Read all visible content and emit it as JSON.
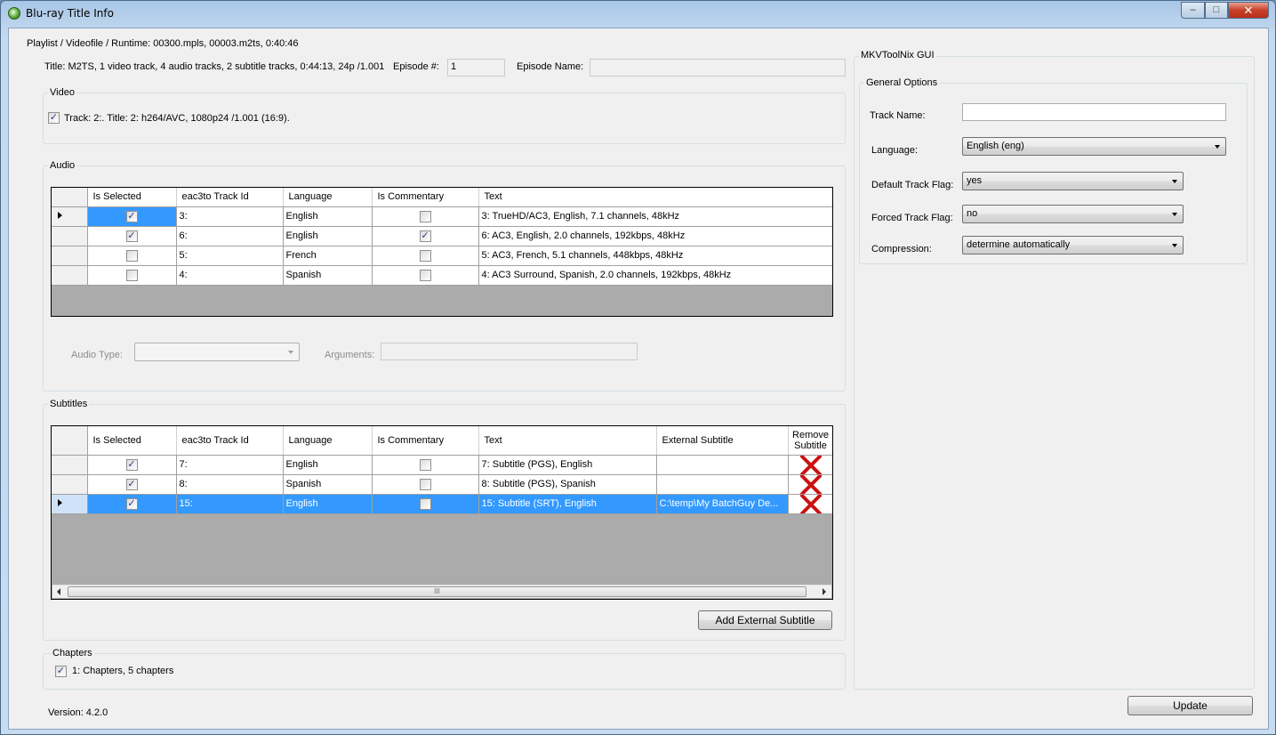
{
  "window": {
    "title": "Blu-ray Title Info",
    "controls": {
      "minimize": "–",
      "maximize": "□",
      "close": "✕"
    }
  },
  "playlist": {
    "label": "Playlist / Videofile / Runtime: 00300.mpls, 00003.m2ts, 0:40:46",
    "title_info": "Title: M2TS, 1 video track, 4 audio tracks, 2 subtitle tracks, 0:44:13, 24p /1.001",
    "episode_num_label": "Episode #:",
    "episode_num_value": "1",
    "episode_name_label": "Episode Name:",
    "episode_name_value": ""
  },
  "video": {
    "label": "Video",
    "track": "Track: 2:. Title: 2: h264/AVC, 1080p24 /1.001 (16:9).",
    "checked": true
  },
  "audio": {
    "label": "Audio",
    "columns": [
      "Is Selected",
      "eac3to Track Id",
      "Language",
      "Is Commentary",
      "Text"
    ],
    "rows": [
      {
        "selected": true,
        "id": "3:",
        "language": "English",
        "commentary": false,
        "text": "3: TrueHD/AC3, English, 7.1 channels, 48kHz",
        "current": true
      },
      {
        "selected": true,
        "id": "6:",
        "language": "English",
        "commentary": true,
        "text": "6: AC3, English, 2.0 channels, 192kbps, 48kHz",
        "current": false
      },
      {
        "selected": false,
        "id": "5:",
        "language": "French",
        "commentary": false,
        "text": "5: AC3, French, 5.1 channels, 448kbps, 48kHz",
        "current": false
      },
      {
        "selected": false,
        "id": "4:",
        "language": "Spanish",
        "commentary": false,
        "text": "4: AC3 Surround, Spanish, 2.0 channels, 192kbps, 48kHz",
        "current": false
      }
    ],
    "audio_type_label": "Audio Type:",
    "audio_type_value": "",
    "arguments_label": "Arguments:",
    "arguments_value": ""
  },
  "subtitles": {
    "label": "Subtitles",
    "columns": [
      "Is Selected",
      "eac3to Track Id",
      "Language",
      "Is Commentary",
      "Text",
      "External Subtitle",
      "Remove Subtitle"
    ],
    "remove_col_line1": "Remove",
    "remove_col_line2": "Subtitle",
    "rows": [
      {
        "selected": true,
        "id": "7:",
        "language": "English",
        "commentary": false,
        "text": "7: Subtitle (PGS), English",
        "external": "",
        "current": false
      },
      {
        "selected": true,
        "id": "8:",
        "language": "Spanish",
        "commentary": false,
        "text": "8: Subtitle (PGS), Spanish",
        "external": "",
        "current": false
      },
      {
        "selected": true,
        "id": "15:",
        "language": "English",
        "commentary": false,
        "text": "15: Subtitle (SRT), English",
        "external": "C:\\temp\\My BatchGuy De...",
        "current": true
      }
    ],
    "scroll_grip": "III",
    "add_button": "Add External Subtitle"
  },
  "chapters": {
    "label": "Chapters",
    "item": "1: Chapters, 5 chapters",
    "checked": true
  },
  "mkv": {
    "label": "MKVToolNix GUI",
    "general_label": "General Options",
    "track_name_label": "Track Name:",
    "track_name_value": "",
    "language_label": "Language:",
    "language_value": "English (eng)",
    "default_flag_label": "Default Track Flag:",
    "default_flag_value": "yes",
    "forced_flag_label": "Forced Track Flag:",
    "forced_flag_value": "no",
    "compression_label": "Compression:",
    "compression_value": "determine automatically"
  },
  "footer": {
    "version": "Version: 4.2.0",
    "update_button": "Update"
  },
  "colors": {
    "selection": "#3399ff",
    "grid_empty": "#ababab",
    "remove_x": "#cc1111"
  }
}
